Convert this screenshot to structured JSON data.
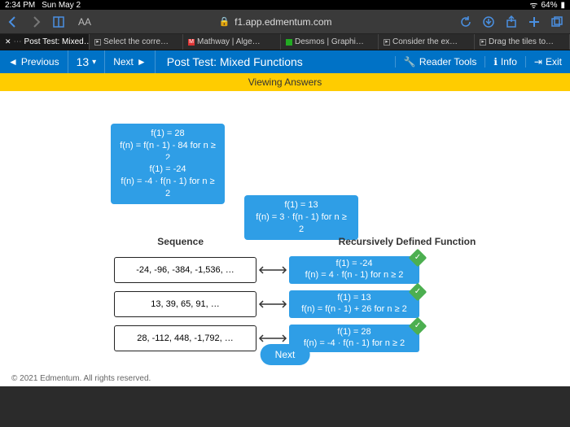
{
  "status": {
    "time": "2:34 PM",
    "date": "Sun May 2",
    "battery": "64%"
  },
  "browser": {
    "aa": "AA",
    "url": "f1.app.edmentum.com",
    "tabs": [
      {
        "label": "Post Test: Mixed…",
        "active": true
      },
      {
        "label": "Select the corre…"
      },
      {
        "label": "Mathway | Alge…"
      },
      {
        "label": "Desmos | Graphi…"
      },
      {
        "label": "Consider the ex…"
      },
      {
        "label": "Drag the tiles to…"
      }
    ]
  },
  "toolbar": {
    "prev": "Previous",
    "num": "13",
    "next": "Next",
    "title": "Post Test: Mixed Functions",
    "reader": "Reader Tools",
    "info": "Info",
    "exit": "Exit"
  },
  "banner": "Viewing Answers",
  "choices": {
    "c1a": "f(1) = 28",
    "c1b": "f(n) = f(n - 1) - 84 for n ≥ 2",
    "c2a": "f(1) = -24",
    "c2b": "f(n) = -4 · f(n - 1) for n ≥ 2",
    "c3a": "f(1) = 13",
    "c3b": "f(n) = 3 · f(n - 1) for n ≥ 2"
  },
  "headers": {
    "left": "Sequence",
    "right": "Recursively Defined Function"
  },
  "rows": [
    {
      "seq": "-24, -96, -384, -1,536, …",
      "a1": "f(1) = -24",
      "a2": "f(n) = 4 · f(n - 1) for n ≥ 2"
    },
    {
      "seq": "13, 39, 65, 91, …",
      "a1": "f(1) = 13",
      "a2": "f(n) = f(n - 1) + 26 for n ≥ 2"
    },
    {
      "seq": "28, -112, 448, -1,792, …",
      "a1": "f(1) = 28",
      "a2": "f(n) = -4 · f(n - 1) for n ≥ 2"
    }
  ],
  "nextBtn": "Next",
  "footer": "© 2021 Edmentum. All rights reserved."
}
